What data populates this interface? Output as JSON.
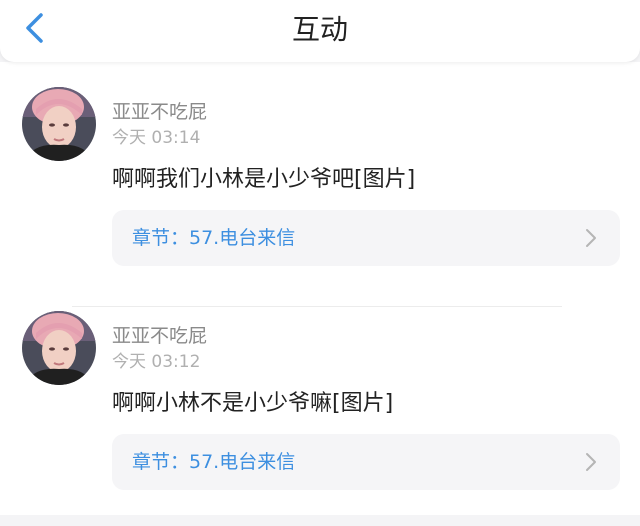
{
  "header": {
    "title": "互动",
    "back_icon": "chevron-left-icon"
  },
  "colors": {
    "accent": "#3d8fe0",
    "username": "#8a8a8a",
    "timestamp": "#b0b0b0",
    "card_background": "#f5f5f7"
  },
  "posts": [
    {
      "username": "亚亚不吃屁",
      "time": "今天 03:14",
      "content": "啊啊我们小林是小少爷吧[图片]",
      "chapter": "章节：57.电台来信",
      "chapter_icon": "chevron-right-icon"
    },
    {
      "username": "亚亚不吃屁",
      "time": "今天 03:12",
      "content": "啊啊小林不是小少爷嘛[图片]",
      "chapter": "章节：57.电台来信",
      "chapter_icon": "chevron-right-icon"
    }
  ]
}
